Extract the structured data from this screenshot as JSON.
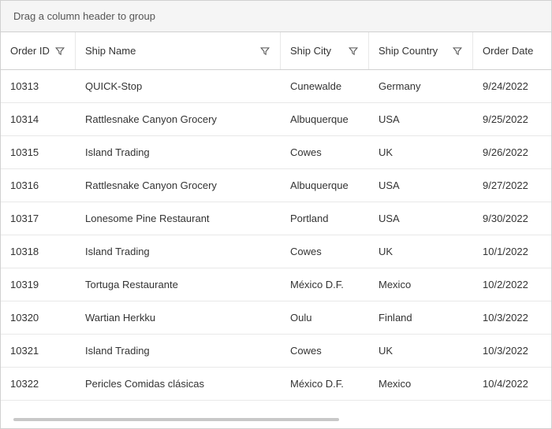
{
  "groupPanel": {
    "hint": "Drag a column header to group"
  },
  "columns": [
    {
      "key": "orderId",
      "label": "Order ID",
      "hasFilter": true,
      "cls": "col-order-id"
    },
    {
      "key": "shipName",
      "label": "Ship Name",
      "hasFilter": true,
      "cls": "col-ship-name"
    },
    {
      "key": "shipCity",
      "label": "Ship City",
      "hasFilter": true,
      "cls": "col-ship-city"
    },
    {
      "key": "shipCountry",
      "label": "Ship Country",
      "hasFilter": true,
      "cls": "col-ship-country"
    },
    {
      "key": "orderDate",
      "label": "Order Date",
      "hasFilter": false,
      "cls": "col-order-date"
    }
  ],
  "rows": [
    {
      "orderId": "10313",
      "shipName": "QUICK-Stop",
      "shipCity": "Cunewalde",
      "shipCountry": "Germany",
      "orderDate": "9/24/2022"
    },
    {
      "orderId": "10314",
      "shipName": "Rattlesnake Canyon Grocery",
      "shipCity": "Albuquerque",
      "shipCountry": "USA",
      "orderDate": "9/25/2022"
    },
    {
      "orderId": "10315",
      "shipName": "Island Trading",
      "shipCity": "Cowes",
      "shipCountry": "UK",
      "orderDate": "9/26/2022"
    },
    {
      "orderId": "10316",
      "shipName": "Rattlesnake Canyon Grocery",
      "shipCity": "Albuquerque",
      "shipCountry": "USA",
      "orderDate": "9/27/2022"
    },
    {
      "orderId": "10317",
      "shipName": "Lonesome Pine Restaurant",
      "shipCity": "Portland",
      "shipCountry": "USA",
      "orderDate": "9/30/2022"
    },
    {
      "orderId": "10318",
      "shipName": "Island Trading",
      "shipCity": "Cowes",
      "shipCountry": "UK",
      "orderDate": "10/1/2022"
    },
    {
      "orderId": "10319",
      "shipName": "Tortuga Restaurante",
      "shipCity": "México D.F.",
      "shipCountry": "Mexico",
      "orderDate": "10/2/2022"
    },
    {
      "orderId": "10320",
      "shipName": "Wartian Herkku",
      "shipCity": "Oulu",
      "shipCountry": "Finland",
      "orderDate": "10/3/2022"
    },
    {
      "orderId": "10321",
      "shipName": "Island Trading",
      "shipCity": "Cowes",
      "shipCountry": "UK",
      "orderDate": "10/3/2022"
    },
    {
      "orderId": "10322",
      "shipName": "Pericles Comidas clásicas",
      "shipCity": "México D.F.",
      "shipCountry": "Mexico",
      "orderDate": "10/4/2022"
    }
  ]
}
